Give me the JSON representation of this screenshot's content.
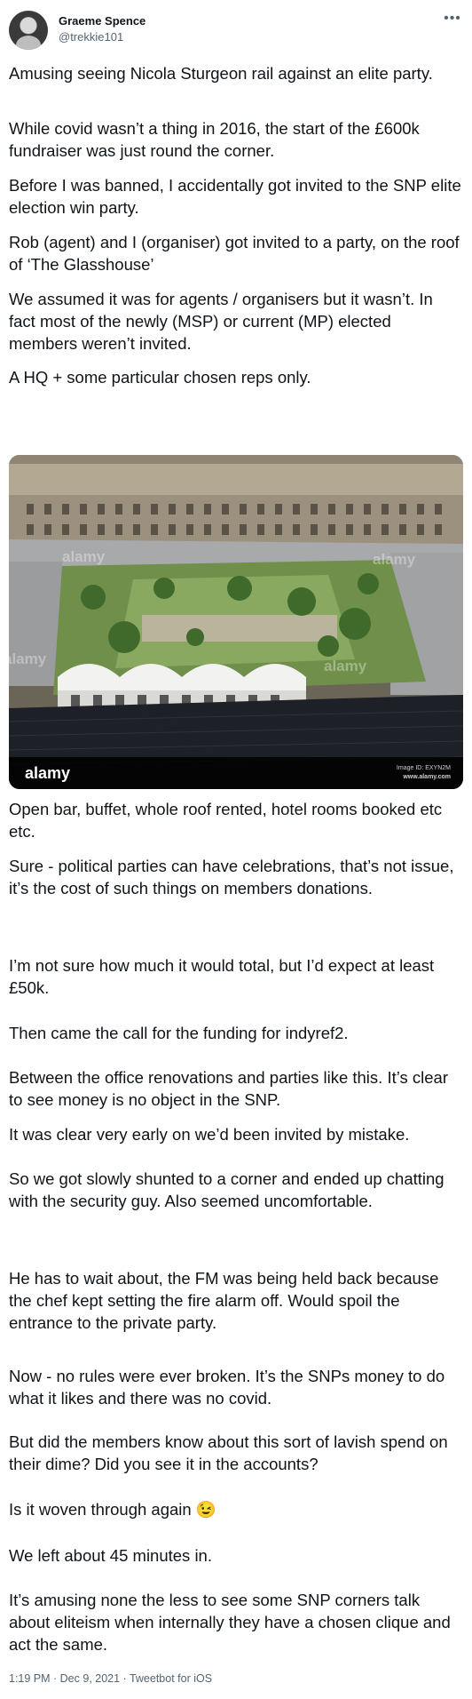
{
  "author": {
    "name": "Graeme Spence",
    "handle": "@trekkie101"
  },
  "menu_icon": "more-horizontal-icon",
  "paragraphs": [
    "Amusing seeing Nicola Sturgeon rail against an elite party.",
    "While covid wasn’t a thing in 2016, the start of the £600k fundraiser was just round the corner.",
    "Before I was banned, I accidentally got invited to the SNP elite election win party.",
    "Rob (agent) and I (organiser) got invited to a party, on the roof of ‘The Glasshouse’",
    "We assumed it was for agents / organisers but it wasn’t. In fact most of the newly (MSP) or current (MP) elected members weren’t invited.",
    "A HQ + some particular chosen reps only.",
    "Open bar, buffet, whole roof rented, hotel rooms booked etc etc.",
    "Sure - political parties can have celebrations, that’s not issue, it’s the cost of such things on members donations.",
    "I’m not sure how much it would total, but I’d expect at least £50k.",
    "Then came the call for the funding for indyref2.",
    "Between the office renovations and parties like this. It’s clear to see money is no object in the SNP.",
    "It was clear very early on we’d been invited by mistake.",
    "So we got slowly shunted to a corner and ended up chatting with the security guy. Also seemed uncomfortable.",
    "He has to wait about, the FM was being held back because the chef kept setting the fire alarm off. Would spoil the entrance to the private party.",
    "Now - no rules were ever broken. It’s the SNPs money to do what it likes and there was no covid.",
    "But did the members know about this sort of lavish spend on their dime? Did you see it in the accounts?",
    "Is it woven through again 😉",
    "We left about 45 minutes in.",
    "It’s amusing none the less to see some SNP corners talk about eliteism when internally they have a chosen clique and act the same."
  ],
  "image": {
    "watermark_brand": "alamy",
    "watermark_corner": "alamy",
    "image_id": "Image ID: EXYN2M",
    "site": "www.alamy.com"
  },
  "footer": "1:19 PM · Dec 9, 2021 · Tweetbot for iOS"
}
